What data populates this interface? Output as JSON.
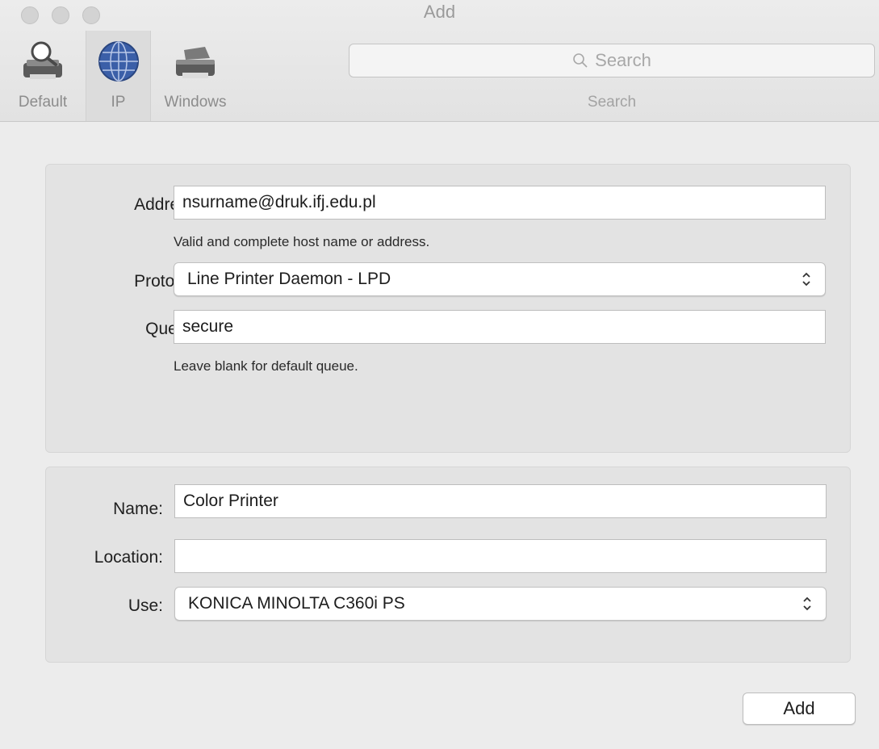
{
  "window": {
    "title": "Add"
  },
  "toolbar": {
    "items": [
      {
        "label": "Default",
        "icon": "printer-magnifier-icon"
      },
      {
        "label": "IP",
        "icon": "globe-icon",
        "selected": true
      },
      {
        "label": "Windows",
        "icon": "printer-icon"
      }
    ],
    "search": {
      "placeholder": "Search",
      "label": "Search"
    }
  },
  "connection": {
    "address": {
      "label": "Address:",
      "value": "nsurname@druk.ifj.edu.pl",
      "hint": "Valid and complete host name or address."
    },
    "protocol": {
      "label": "Protocol:",
      "value": "Line Printer Daemon - LPD"
    },
    "queue": {
      "label": "Queue:",
      "value": "secure",
      "hint": "Leave blank for default queue."
    }
  },
  "printer": {
    "name": {
      "label": "Name:",
      "value": "Color Printer"
    },
    "location": {
      "label": "Location:",
      "value": ""
    },
    "use": {
      "label": "Use:",
      "value": "KONICA MINOLTA C360i PS"
    }
  },
  "actions": {
    "add_label": "Add"
  },
  "colors": {
    "window_bg": "#ececec",
    "group_bg": "#e3e3e3",
    "field_bg": "#ffffff",
    "globe": "#3b5fa8"
  }
}
